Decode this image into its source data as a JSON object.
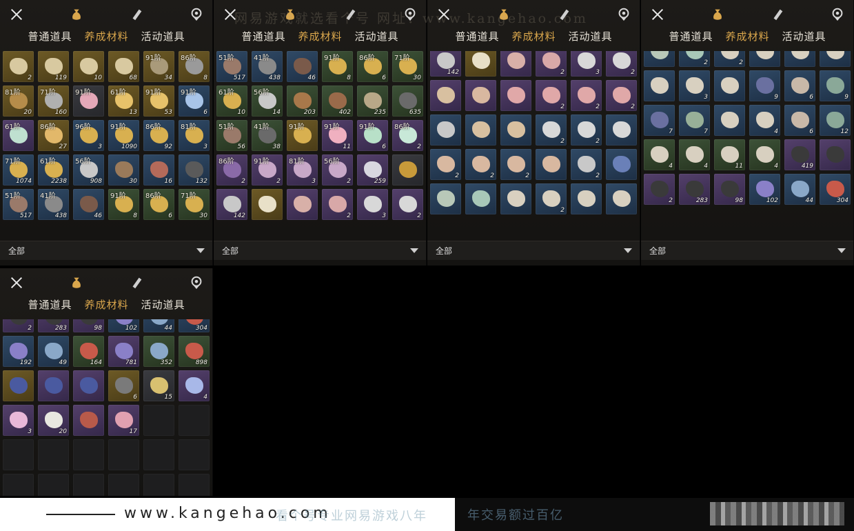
{
  "watermark": "网易游戏就选看个号   网址：www.kangehao.com",
  "banner": {
    "url": "www.kangehao.com",
    "tagline_a": "看个号专业网易游戏八年",
    "tagline_b": "年交易额过百亿"
  },
  "panels": [
    {
      "tabs": [
        "普通道具",
        "养成材料",
        "活动道具"
      ],
      "active_tab": 1,
      "filter": "全部",
      "items": [
        {
          "lvl": "",
          "cnt": "2",
          "c": "gold",
          "col": "#d8c9a0"
        },
        {
          "lvl": "",
          "cnt": "119",
          "c": "gold",
          "col": "#d8c9a0"
        },
        {
          "lvl": "",
          "cnt": "10",
          "c": "gold",
          "col": "#d8c9a0"
        },
        {
          "lvl": "",
          "cnt": "68",
          "c": "gold",
          "col": "#d8c9a0"
        },
        {
          "lvl": "91阶",
          "cnt": "34",
          "c": "gold",
          "col": "#a99a7a"
        },
        {
          "lvl": "86阶",
          "cnt": "8",
          "c": "gold",
          "col": "#9a9a9a"
        },
        {
          "lvl": "81阶",
          "cnt": "20",
          "c": "gold",
          "col": "#b58c4a"
        },
        {
          "lvl": "71阶",
          "cnt": "160",
          "c": "gold",
          "col": "#b0b0b0"
        },
        {
          "lvl": "91阶",
          "cnt": "",
          "c": "gray",
          "col": "#e4a8b8"
        },
        {
          "lvl": "61阶",
          "cnt": "13",
          "c": "gold",
          "col": "#e7c26a"
        },
        {
          "lvl": "91阶",
          "cnt": "53",
          "c": "gold",
          "col": "#e7c26a"
        },
        {
          "lvl": "91阶",
          "cnt": "6",
          "c": "blue",
          "col": "#a8c4e8"
        },
        {
          "lvl": "61阶",
          "cnt": "",
          "c": "purple",
          "col": "#bfe0d0"
        },
        {
          "lvl": "86阶",
          "cnt": "27",
          "c": "gold",
          "col": "#e2b86a"
        },
        {
          "lvl": "96阶",
          "cnt": "3",
          "c": "blue",
          "col": "#d8b050"
        },
        {
          "lvl": "91阶",
          "cnt": "1090",
          "c": "blue",
          "col": "#d8b050"
        },
        {
          "lvl": "86阶",
          "cnt": "92",
          "c": "blue",
          "col": "#d8b050"
        },
        {
          "lvl": "81阶",
          "cnt": "3",
          "c": "blue",
          "col": "#d8b050"
        },
        {
          "lvl": "71阶",
          "cnt": "1074",
          "c": "blue",
          "col": "#d8b050"
        },
        {
          "lvl": "61阶",
          "cnt": "2238",
          "c": "blue",
          "col": "#d8b050"
        },
        {
          "lvl": "56阶",
          "cnt": "908",
          "c": "blue",
          "col": "#c8c8c8"
        },
        {
          "lvl": "",
          "cnt": "30",
          "c": "blue",
          "col": "#9a7a5a"
        },
        {
          "lvl": "",
          "cnt": "16",
          "c": "blue",
          "col": "#b46a5a"
        },
        {
          "lvl": "",
          "cnt": "132",
          "c": "blue",
          "col": "#5a5a5a"
        },
        {
          "lvl": "51阶",
          "cnt": "517",
          "c": "blue",
          "col": "#9a7a6a"
        },
        {
          "lvl": "41阶",
          "cnt": "438",
          "c": "blue",
          "col": "#8a8a8a"
        },
        {
          "lvl": "",
          "cnt": "46",
          "c": "blue",
          "col": "#7a5a4a"
        },
        {
          "lvl": "91阶",
          "cnt": "8",
          "c": "green",
          "col": "#d8b050"
        },
        {
          "lvl": "86阶",
          "cnt": "6",
          "c": "green",
          "col": "#d8b050"
        },
        {
          "lvl": "71阶",
          "cnt": "30",
          "c": "green",
          "col": "#d8b050"
        }
      ]
    },
    {
      "tabs": [
        "普通道具",
        "养成材料",
        "活动道具"
      ],
      "active_tab": 1,
      "filter": "全部",
      "items": [
        {
          "lvl": "51阶",
          "cnt": "517",
          "c": "blue",
          "col": "#9a7a6a"
        },
        {
          "lvl": "41阶",
          "cnt": "438",
          "c": "blue",
          "col": "#8a8a8a"
        },
        {
          "lvl": "",
          "cnt": "46",
          "c": "blue",
          "col": "#7a5a4a"
        },
        {
          "lvl": "91阶",
          "cnt": "8",
          "c": "green",
          "col": "#d8b050"
        },
        {
          "lvl": "86阶",
          "cnt": "6",
          "c": "green",
          "col": "#d8b050"
        },
        {
          "lvl": "71阶",
          "cnt": "30",
          "c": "green",
          "col": "#d8b050"
        },
        {
          "lvl": "61阶",
          "cnt": "10",
          "c": "green",
          "col": "#d8b050"
        },
        {
          "lvl": "56阶",
          "cnt": "14",
          "c": "green",
          "col": "#c8c8c8"
        },
        {
          "lvl": "",
          "cnt": "203",
          "c": "green",
          "col": "#a8784a"
        },
        {
          "lvl": "",
          "cnt": "402",
          "c": "green",
          "col": "#9a6a4a"
        },
        {
          "lvl": "",
          "cnt": "235",
          "c": "green",
          "col": "#b8a888"
        },
        {
          "lvl": "",
          "cnt": "635",
          "c": "green",
          "col": "#6a6a6a"
        },
        {
          "lvl": "51阶",
          "cnt": "56",
          "c": "green",
          "col": "#9a7a6a"
        },
        {
          "lvl": "41阶",
          "cnt": "38",
          "c": "green",
          "col": "#6a6a6a"
        },
        {
          "lvl": "91阶",
          "cnt": "",
          "c": "gold",
          "col": "#d8b050"
        },
        {
          "lvl": "91阶",
          "cnt": "11",
          "c": "purple",
          "col": "#f0b0c0"
        },
        {
          "lvl": "91阶",
          "cnt": "6",
          "c": "purple",
          "col": "#b8e0c8"
        },
        {
          "lvl": "86阶",
          "cnt": "2",
          "c": "purple",
          "col": "#c8e8d8"
        },
        {
          "lvl": "86阶",
          "cnt": "2",
          "c": "purple",
          "col": "#8a6aa8"
        },
        {
          "lvl": "91阶",
          "cnt": "2",
          "c": "purple",
          "col": "#c8a8c8"
        },
        {
          "lvl": "81阶",
          "cnt": "3",
          "c": "purple",
          "col": "#c8a8c8"
        },
        {
          "lvl": "56阶",
          "cnt": "2",
          "c": "purple",
          "col": "#c8a8c8"
        },
        {
          "lvl": "",
          "cnt": "259",
          "c": "purple",
          "col": "#d8d8e0"
        },
        {
          "lvl": "",
          "cnt": "",
          "c": "gray",
          "col": "#c89a3a"
        },
        {
          "lvl": "",
          "cnt": "142",
          "c": "purple",
          "col": "#c8c8c8"
        },
        {
          "lvl": "",
          "cnt": "",
          "c": "gold",
          "col": "#e8e0c8"
        },
        {
          "lvl": "",
          "cnt": "",
          "c": "purple",
          "col": "#d8b0a8"
        },
        {
          "lvl": "",
          "cnt": "2",
          "c": "purple",
          "col": "#d8a8a8"
        },
        {
          "lvl": "",
          "cnt": "3",
          "c": "purple",
          "col": "#d8d8d8"
        },
        {
          "lvl": "",
          "cnt": "2",
          "c": "purple",
          "col": "#d8d8d8"
        }
      ]
    },
    {
      "tabs": [
        "普通道具",
        "养成材料",
        "活动道具"
      ],
      "active_tab": 1,
      "filter": "全部",
      "items": [
        {
          "lvl": "",
          "cnt": "142",
          "c": "purple",
          "col": "#c8c8c8"
        },
        {
          "lvl": "",
          "cnt": "",
          "c": "gold",
          "col": "#e8e0c8"
        },
        {
          "lvl": "",
          "cnt": "",
          "c": "purple",
          "col": "#d8b0a8"
        },
        {
          "lvl": "",
          "cnt": "2",
          "c": "purple",
          "col": "#d8a8a8"
        },
        {
          "lvl": "",
          "cnt": "3",
          "c": "purple",
          "col": "#d8d8d8"
        },
        {
          "lvl": "",
          "cnt": "2",
          "c": "purple",
          "col": "#d8d8d8"
        },
        {
          "lvl": "",
          "cnt": "",
          "c": "purple",
          "col": "#d8c0a0"
        },
        {
          "lvl": "",
          "cnt": "",
          "c": "purple",
          "col": "#d8b8a0"
        },
        {
          "lvl": "",
          "cnt": "",
          "c": "purple",
          "col": "#e0a8a8"
        },
        {
          "lvl": "",
          "cnt": "2",
          "c": "purple",
          "col": "#e0a8a8"
        },
        {
          "lvl": "",
          "cnt": "2",
          "c": "purple",
          "col": "#e0a8a8"
        },
        {
          "lvl": "",
          "cnt": "2",
          "c": "purple",
          "col": "#e0a8a8"
        },
        {
          "lvl": "",
          "cnt": "",
          "c": "blue",
          "col": "#c8c8c8"
        },
        {
          "lvl": "",
          "cnt": "",
          "c": "blue",
          "col": "#d8c0a0"
        },
        {
          "lvl": "",
          "cnt": "",
          "c": "blue",
          "col": "#d8c0a0"
        },
        {
          "lvl": "",
          "cnt": "2",
          "c": "blue",
          "col": "#d8d8d8"
        },
        {
          "lvl": "",
          "cnt": "2",
          "c": "blue",
          "col": "#d8d8d8"
        },
        {
          "lvl": "",
          "cnt": "",
          "c": "blue",
          "col": "#d8d8d8"
        },
        {
          "lvl": "",
          "cnt": "2",
          "c": "blue",
          "col": "#d8b8a0"
        },
        {
          "lvl": "",
          "cnt": "2",
          "c": "blue",
          "col": "#d8b8a0"
        },
        {
          "lvl": "",
          "cnt": "2",
          "c": "blue",
          "col": "#d8b8a0"
        },
        {
          "lvl": "",
          "cnt": "",
          "c": "blue",
          "col": "#d8b8a0"
        },
        {
          "lvl": "",
          "cnt": "2",
          "c": "blue",
          "col": "#c8c8c8"
        },
        {
          "lvl": "",
          "cnt": "",
          "c": "blue",
          "col": "#6a80b8"
        },
        {
          "lvl": "",
          "cnt": "",
          "c": "blue",
          "col": "#b8c8b8"
        },
        {
          "lvl": "",
          "cnt": "",
          "c": "blue",
          "col": "#a8c8b8"
        },
        {
          "lvl": "",
          "cnt": "",
          "c": "blue",
          "col": "#d8d0c0"
        },
        {
          "lvl": "",
          "cnt": "2",
          "c": "blue",
          "col": "#d8d0c0"
        },
        {
          "lvl": "",
          "cnt": "",
          "c": "blue",
          "col": "#d8d0c0"
        },
        {
          "lvl": "",
          "cnt": "",
          "c": "blue",
          "col": "#d8d0c0"
        }
      ]
    },
    {
      "tabs": [
        "普通道具",
        "养成材料",
        "活动道具"
      ],
      "active_tab": 1,
      "filter": "全部",
      "items": [
        {
          "lvl": "",
          "cnt": "",
          "c": "blue",
          "col": "#b8c8b8"
        },
        {
          "lvl": "",
          "cnt": "2",
          "c": "blue",
          "col": "#a8c8b8"
        },
        {
          "lvl": "",
          "cnt": "2",
          "c": "blue",
          "col": "#d8d0c0"
        },
        {
          "lvl": "",
          "cnt": "",
          "c": "blue",
          "col": "#d8d0c0"
        },
        {
          "lvl": "",
          "cnt": "",
          "c": "blue",
          "col": "#d8d0c0"
        },
        {
          "lvl": "",
          "cnt": "",
          "c": "blue",
          "col": "#d8d0c0"
        },
        {
          "lvl": "",
          "cnt": "",
          "c": "blue",
          "col": "#d8d0c0"
        },
        {
          "lvl": "",
          "cnt": "3",
          "c": "blue",
          "col": "#d8d0c0"
        },
        {
          "lvl": "",
          "cnt": "",
          "c": "blue",
          "col": "#d8d0c0"
        },
        {
          "lvl": "",
          "cnt": "9",
          "c": "blue",
          "col": "#6a70a0"
        },
        {
          "lvl": "",
          "cnt": "6",
          "c": "blue",
          "col": "#c8b8a8"
        },
        {
          "lvl": "",
          "cnt": "9",
          "c": "blue",
          "col": "#8aa898"
        },
        {
          "lvl": "",
          "cnt": "7",
          "c": "blue",
          "col": "#6a70a0"
        },
        {
          "lvl": "",
          "cnt": "7",
          "c": "blue",
          "col": "#98b098"
        },
        {
          "lvl": "",
          "cnt": "",
          "c": "blue",
          "col": "#d8d0c0"
        },
        {
          "lvl": "",
          "cnt": "4",
          "c": "blue",
          "col": "#d8d0c0"
        },
        {
          "lvl": "",
          "cnt": "6",
          "c": "blue",
          "col": "#c8b8a8"
        },
        {
          "lvl": "",
          "cnt": "12",
          "c": "blue",
          "col": "#8aa898"
        },
        {
          "lvl": "",
          "cnt": "4",
          "c": "green",
          "col": "#d8d0c0"
        },
        {
          "lvl": "",
          "cnt": "4",
          "c": "green",
          "col": "#d8d0c0"
        },
        {
          "lvl": "",
          "cnt": "11",
          "c": "green",
          "col": "#d8d0c0"
        },
        {
          "lvl": "",
          "cnt": "4",
          "c": "green",
          "col": "#d8d0c0"
        },
        {
          "lvl": "",
          "cnt": "419",
          "c": "purple",
          "col": "#3a3a3a"
        },
        {
          "lvl": "",
          "cnt": "",
          "c": "purple",
          "col": "#3a3a3a"
        },
        {
          "lvl": "",
          "cnt": "2",
          "c": "purple",
          "col": "#3a3a3a"
        },
        {
          "lvl": "",
          "cnt": "283",
          "c": "purple",
          "col": "#3a3a3a"
        },
        {
          "lvl": "",
          "cnt": "98",
          "c": "purple",
          "col": "#3a3a3a"
        },
        {
          "lvl": "",
          "cnt": "102",
          "c": "blue",
          "col": "#8a80c8"
        },
        {
          "lvl": "",
          "cnt": "44",
          "c": "blue",
          "col": "#8aa8c8"
        },
        {
          "lvl": "",
          "cnt": "304",
          "c": "blue",
          "col": "#c85a4a"
        }
      ]
    },
    {
      "tabs": [
        "普通道具",
        "养成材料",
        "活动道具"
      ],
      "active_tab": 1,
      "items": [
        {
          "lvl": "",
          "cnt": "2",
          "c": "purple",
          "col": "#3a3a3a"
        },
        {
          "lvl": "",
          "cnt": "283",
          "c": "purple",
          "col": "#3a3a3a"
        },
        {
          "lvl": "",
          "cnt": "98",
          "c": "purple",
          "col": "#3a3a3a"
        },
        {
          "lvl": "",
          "cnt": "102",
          "c": "blue",
          "col": "#8a80c8"
        },
        {
          "lvl": "",
          "cnt": "44",
          "c": "blue",
          "col": "#8aa8c8"
        },
        {
          "lvl": "",
          "cnt": "304",
          "c": "blue",
          "col": "#c85a4a"
        },
        {
          "lvl": "",
          "cnt": "192",
          "c": "blue",
          "col": "#8a80c8"
        },
        {
          "lvl": "",
          "cnt": "49",
          "c": "blue",
          "col": "#8aa8c8"
        },
        {
          "lvl": "",
          "cnt": "164",
          "c": "green",
          "col": "#c85a4a"
        },
        {
          "lvl": "",
          "cnt": "781",
          "c": "purple",
          "col": "#8a80c8"
        },
        {
          "lvl": "",
          "cnt": "352",
          "c": "green",
          "col": "#8aa8c8"
        },
        {
          "lvl": "",
          "cnt": "898",
          "c": "green",
          "col": "#c85a4a"
        },
        {
          "lvl": "",
          "cnt": "",
          "c": "gold",
          "col": "#4a5aa0"
        },
        {
          "lvl": "",
          "cnt": "",
          "c": "purple",
          "col": "#4a5aa0"
        },
        {
          "lvl": "",
          "cnt": "",
          "c": "purple",
          "col": "#4a5aa0"
        },
        {
          "lvl": "",
          "cnt": "6",
          "c": "gold",
          "col": "#7a7a7a"
        },
        {
          "lvl": "",
          "cnt": "15",
          "c": "gray",
          "col": "#d8c070"
        },
        {
          "lvl": "",
          "cnt": "4",
          "c": "purple",
          "col": "#a8b8e8"
        },
        {
          "lvl": "",
          "cnt": "3",
          "c": "purple",
          "col": "#e8b8d8"
        },
        {
          "lvl": "",
          "cnt": "20",
          "c": "purple",
          "col": "#e8e8e0"
        },
        {
          "lvl": "",
          "cnt": "",
          "c": "purple",
          "col": "#b85a4a"
        },
        {
          "lvl": "",
          "cnt": "17",
          "c": "purple",
          "col": "#e0a0b0"
        },
        {
          "lvl": "",
          "cnt": "",
          "c": "empty",
          "col": ""
        },
        {
          "lvl": "",
          "cnt": "",
          "c": "empty",
          "col": ""
        },
        {
          "lvl": "",
          "cnt": "",
          "c": "empty",
          "col": ""
        },
        {
          "lvl": "",
          "cnt": "",
          "c": "empty",
          "col": ""
        },
        {
          "lvl": "",
          "cnt": "",
          "c": "empty",
          "col": ""
        },
        {
          "lvl": "",
          "cnt": "",
          "c": "empty",
          "col": ""
        },
        {
          "lvl": "",
          "cnt": "",
          "c": "empty",
          "col": ""
        },
        {
          "lvl": "",
          "cnt": "",
          "c": "empty",
          "col": ""
        },
        {
          "lvl": "",
          "cnt": "",
          "c": "empty",
          "col": ""
        },
        {
          "lvl": "",
          "cnt": "",
          "c": "empty",
          "col": ""
        },
        {
          "lvl": "",
          "cnt": "",
          "c": "empty",
          "col": ""
        },
        {
          "lvl": "",
          "cnt": "",
          "c": "empty",
          "col": ""
        },
        {
          "lvl": "",
          "cnt": "",
          "c": "empty",
          "col": ""
        },
        {
          "lvl": "",
          "cnt": "",
          "c": "empty",
          "col": ""
        }
      ]
    }
  ]
}
